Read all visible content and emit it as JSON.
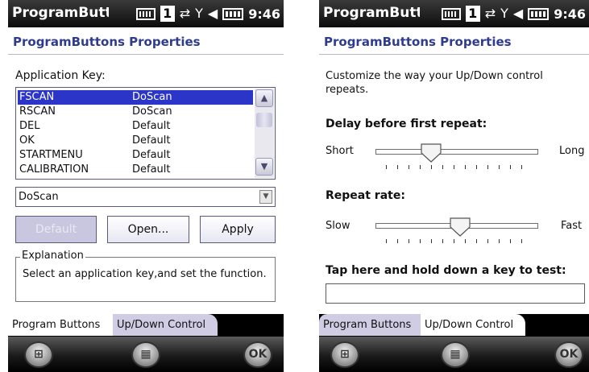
{
  "left": {
    "status": {
      "title": "ProgramButt",
      "one": "1",
      "time": "9:46"
    },
    "header": "ProgramButtons Properties",
    "app_key_label": "Application Key:",
    "list": [
      {
        "key": "FSCAN",
        "func": "DoScan",
        "selected": true
      },
      {
        "key": "RSCAN",
        "func": "DoScan",
        "selected": false
      },
      {
        "key": "DEL",
        "func": "Default",
        "selected": false
      },
      {
        "key": "OK",
        "func": "Default",
        "selected": false
      },
      {
        "key": "STARTMENU",
        "func": "Default",
        "selected": false
      },
      {
        "key": "CALIBRATION",
        "func": "Default",
        "selected": false
      }
    ],
    "combo_value": "DoScan",
    "buttons": {
      "default": "Default",
      "open": "Open...",
      "apply": "Apply"
    },
    "explanation": {
      "legend": "Explanation",
      "text": "Select an application key,and set the function."
    },
    "tabs": {
      "program_buttons": "Program Buttons",
      "updown": "Up/Down Control"
    },
    "softkeys": {
      "ok": "OK"
    }
  },
  "right": {
    "status": {
      "title": "ProgramButt",
      "one": "1",
      "time": "9:46"
    },
    "header": "ProgramButtons Properties",
    "description": "Customize the way your Up/Down control repeats.",
    "delay_label": "Delay before first repeat:",
    "delay_min": "Short",
    "delay_max": "Long",
    "delay_value": 0.34,
    "rate_label": "Repeat rate:",
    "rate_min": "Slow",
    "rate_max": "Fast",
    "rate_value": 0.52,
    "test_label": "Tap here and hold down a key to test:",
    "tabs": {
      "program_buttons": "Program Buttons",
      "updown": "Up/Down Control"
    },
    "softkeys": {
      "ok": "OK"
    }
  },
  "colors": {
    "header_text": "#2f3c8d",
    "selection": "#2b36c8",
    "disabled_button": "#c9c6df",
    "inactive_tab": "#cfcce4"
  },
  "icons": [
    "signal-icon",
    "antenna-icon",
    "volume-icon",
    "battery-icon",
    "windows-start-icon",
    "keyboard-icon"
  ]
}
